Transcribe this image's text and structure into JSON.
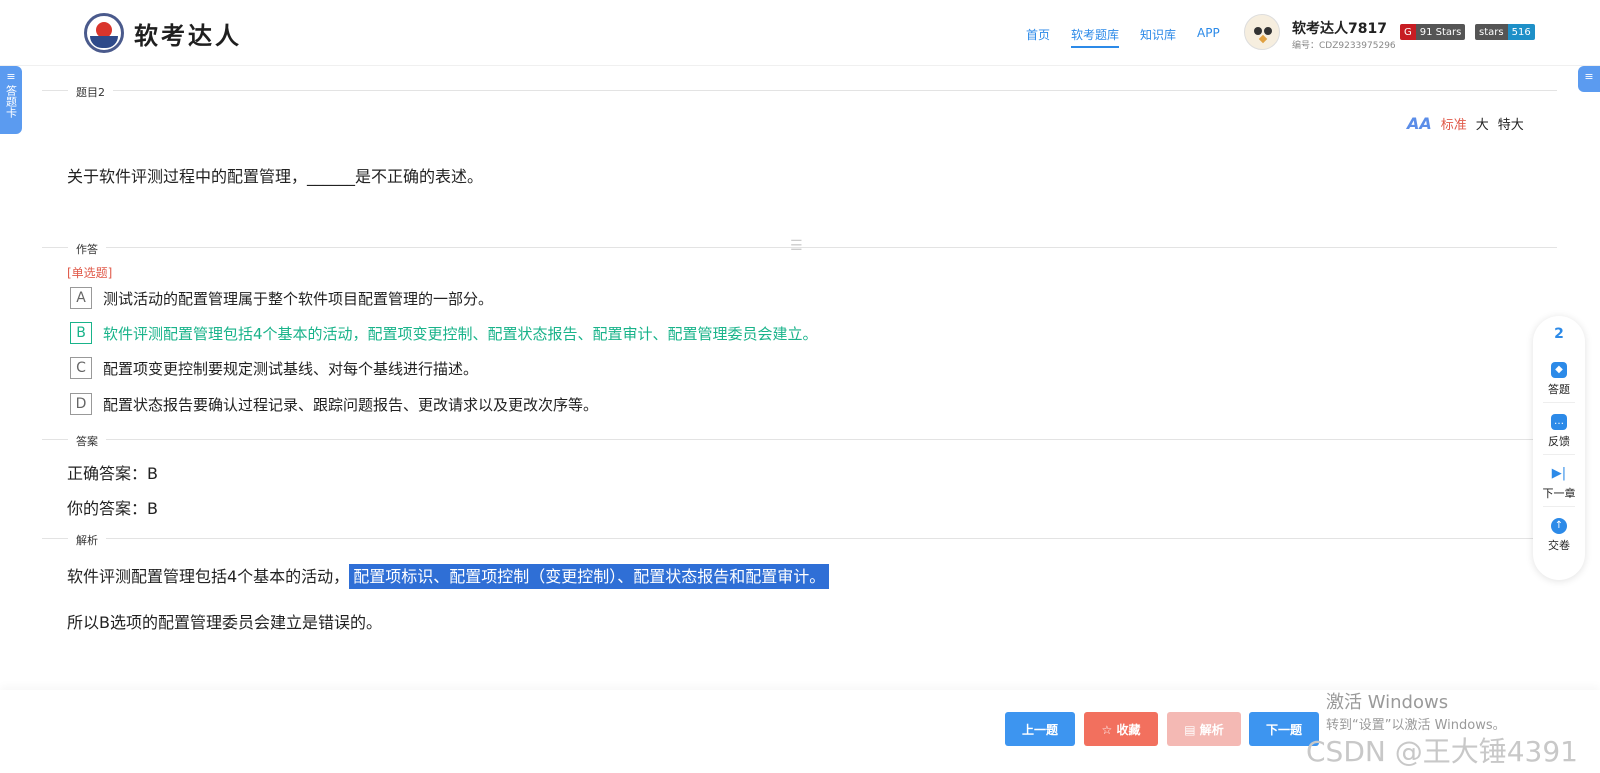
{
  "header": {
    "logo_text": "软考达人",
    "nav": [
      "首页",
      "软考题库",
      "知识库",
      "APP"
    ],
    "active_nav": "软考题库",
    "user_name": "软考达人7817",
    "user_id": "编号：CDZ9233975296",
    "badge_gitee": {
      "left": "G",
      "right": "91 Stars",
      "color": "#c71d23"
    },
    "badge_github": {
      "left": "stars",
      "right": "516",
      "color": "#1e90c8"
    }
  },
  "side_tab": {
    "icon": "≡",
    "label": "答题卡"
  },
  "section_labels": {
    "question": "题目2",
    "answer_area": "作答",
    "answer": "答案",
    "analysis": "解析"
  },
  "font_size": {
    "options": [
      "标准",
      "大",
      "特大"
    ],
    "active": "标准"
  },
  "question": {
    "text": "关于软件评测过程中的配置管理，______是不正确的表述。",
    "type": "[单选题]"
  },
  "options": [
    {
      "key": "A",
      "text": "测试活动的配置管理属于整个软件项目配置管理的一部分。",
      "selected": false
    },
    {
      "key": "B",
      "text": "软件评测配置管理包括4个基本的活动，配置项变更控制、配置状态报告、配置审计、配置管理委员会建立。",
      "selected": true
    },
    {
      "key": "C",
      "text": "配置项变更控制要规定测试基线、对每个基线进行描述。",
      "selected": false
    },
    {
      "key": "D",
      "text": "配置状态报告要确认过程记录、跟踪问题报告、更改请求以及更改次序等。",
      "selected": false
    }
  ],
  "answer": {
    "correct": "正确答案：B",
    "yours": "你的答案：B"
  },
  "analysis": {
    "line1_prefix": "软件评测配置管理包括4个基本的活动，",
    "line1_highlight": "配置项标识、配置项控制（变更控制）、配置状态报告和配置审计。",
    "line2": "所以B选项的配置管理委员会建立是错误的。"
  },
  "float_panel": {
    "number": "2",
    "items": [
      "答题",
      "反馈",
      "下一章",
      "交卷"
    ]
  },
  "buttons": {
    "prev": {
      "label": "上一题",
      "color": "#3d95f0"
    },
    "fav": {
      "label": "☆ 收藏",
      "color": "#f2705e"
    },
    "analysis": {
      "label": "▤ 解析",
      "color": "#f4b9b4"
    },
    "next": {
      "label": "下一题",
      "color": "#3d95f0"
    }
  },
  "watermark": {
    "line1": "激活 Windows",
    "line2": "转到“设置”以激活 Windows。",
    "line3": "CSDN @王大锤4391"
  }
}
